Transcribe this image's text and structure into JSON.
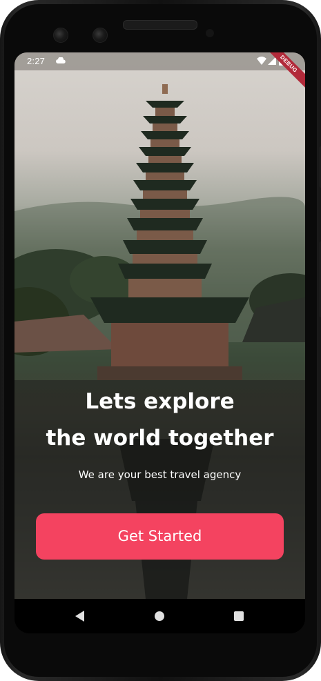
{
  "status_bar": {
    "time": "2:27",
    "debug_label": "DEBUG"
  },
  "onboarding": {
    "headline_line1": "Lets explore",
    "headline_line2": "the world together",
    "subtitle": "We are your best travel agency",
    "cta_label": "Get Started"
  },
  "colors": {
    "accent": "#f44360"
  },
  "icons": [
    "cloud-icon",
    "wifi-icon",
    "signal-icon",
    "battery-icon",
    "back-icon",
    "home-icon",
    "recents-icon"
  ]
}
